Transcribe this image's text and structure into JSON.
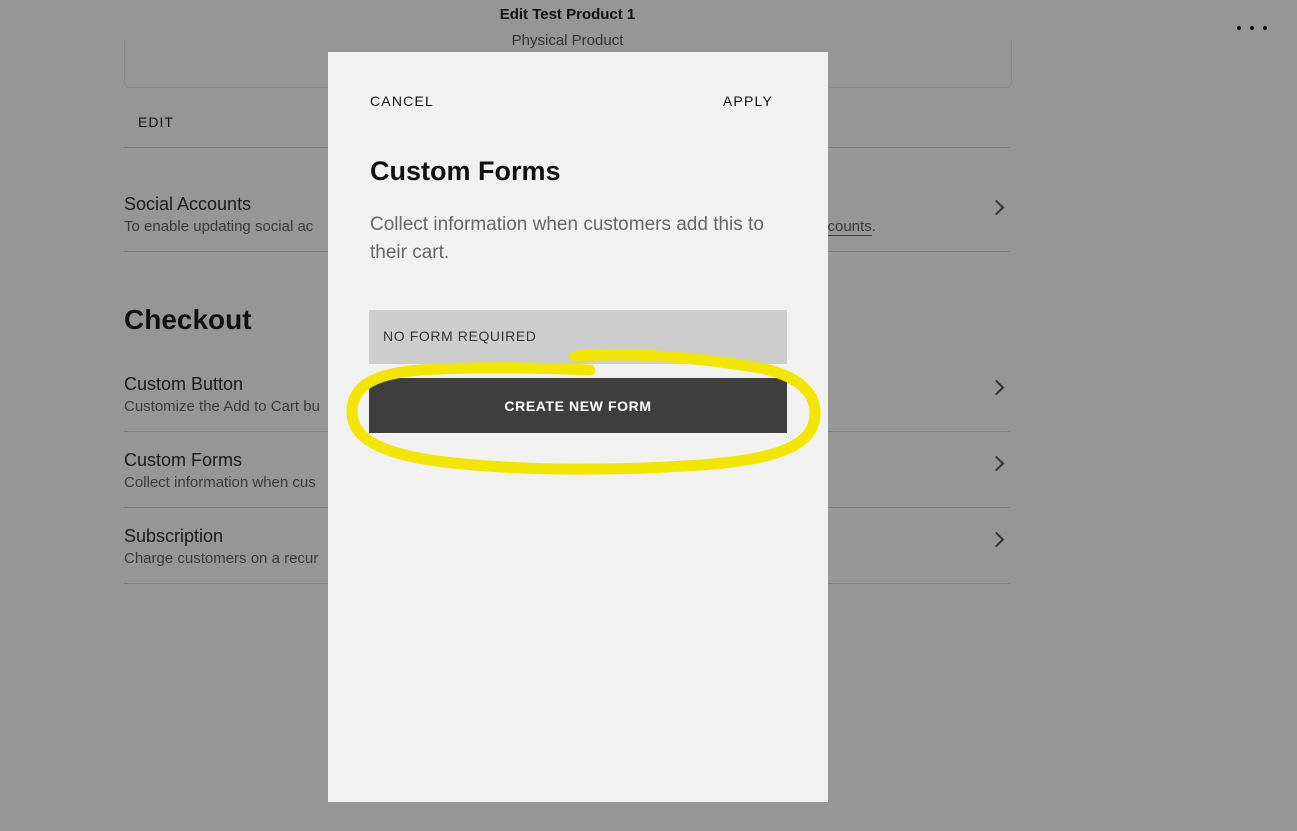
{
  "header": {
    "title": "Edit Test Product 1",
    "subtitle": "Physical Product",
    "more_icon": "more-horizontal-icon"
  },
  "background": {
    "edit_label": "EDIT",
    "social": {
      "title": "Social Accounts",
      "desc_left": "To enable updating social ac",
      "desc_right_link": "ccounts",
      "desc_right_end": "."
    },
    "checkout_title": "Checkout",
    "rows": [
      {
        "title": "Custom Button",
        "desc": "Customize the Add to Cart bu"
      },
      {
        "title": "Custom Forms",
        "desc": "Collect information when cus"
      },
      {
        "title": "Subscription",
        "desc": "Charge customers on a recur"
      }
    ]
  },
  "modal": {
    "cancel_label": "CANCEL",
    "apply_label": "APPLY",
    "title": "Custom Forms",
    "description": "Collect information when customers add this to their cart.",
    "select_value": "NO FORM REQUIRED",
    "create_label": "CREATE NEW FORM"
  },
  "annotation": {
    "color": "#f2e600"
  }
}
